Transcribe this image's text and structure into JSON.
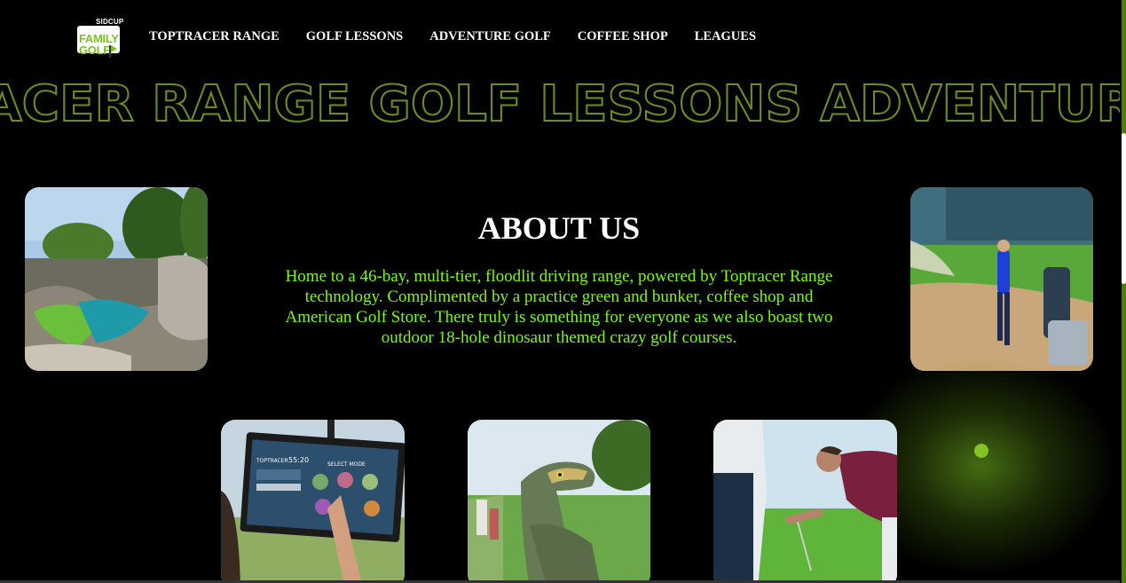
{
  "brand": {
    "logo_sub": "SIDCUP",
    "logo_line1": "FAMILY",
    "logo_line2": "GOLF"
  },
  "nav": {
    "items": [
      {
        "label": "TOPTRACER RANGE"
      },
      {
        "label": "GOLF LESSONS"
      },
      {
        "label": "ADVENTURE GOLF"
      },
      {
        "label": "COFFEE SHOP"
      },
      {
        "label": "LEAGUES"
      }
    ]
  },
  "marquee": {
    "text": "ACER RANGE GOLF LESSONS ADVENTUR"
  },
  "about": {
    "title": "ABOUT US",
    "body": "Home to a 46-bay, multi-tier, floodlit driving range, powered by Toptracer Range technology. Complimented by a practice green and bunker, coffee shop and American Golf Store. There truly is something for everyone as we also boast two outdoor 18-hole dinosaur themed crazy golf courses."
  },
  "photos": {
    "screen_title": "TOPTRACER",
    "screen_time": "55:20",
    "screen_mode": "SELECT MODE"
  },
  "colors": {
    "accent": "#7cfc00",
    "brand_green": "#7cc423",
    "outline_green": "#6b8e23",
    "background": "#000000"
  }
}
